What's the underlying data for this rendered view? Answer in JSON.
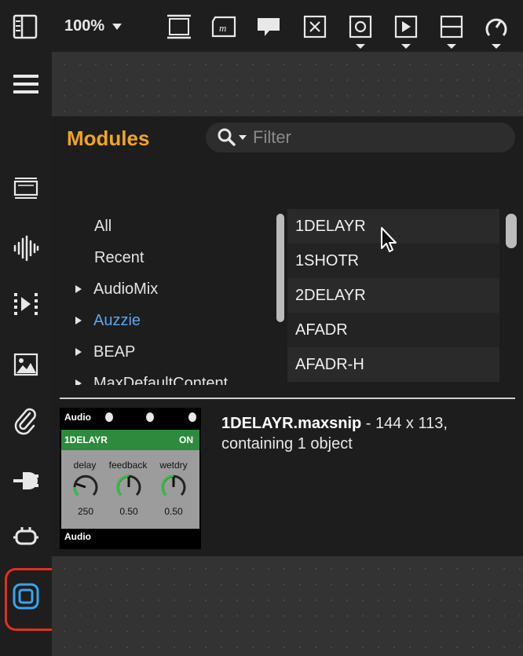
{
  "toolbar": {
    "zoom_value": "100%",
    "icons": [
      "sidebar-toggle-icon",
      "presentation-icon",
      "comment-icon",
      "message-icon",
      "x-box-icon",
      "button-icon",
      "play-icon",
      "slider-icon",
      "dial-icon"
    ]
  },
  "sidebar": {
    "icons": [
      "menu-icon",
      "video-icon",
      "audio-icon",
      "media-icon",
      "image-icon",
      "attachment-icon",
      "plug-icon",
      "connector-icon",
      "snippet-icon"
    ]
  },
  "browser": {
    "title": "Modules",
    "filter_placeholder": "Filter",
    "categories": [
      {
        "label": "All",
        "expandable": false
      },
      {
        "label": "Recent",
        "expandable": false
      },
      {
        "label": "AudioMix",
        "expandable": true
      },
      {
        "label": "Auzzie",
        "expandable": true,
        "active": true
      },
      {
        "label": "BEAP",
        "expandable": true
      },
      {
        "label": "MaxDefaultContent",
        "expandable": true
      }
    ],
    "modules": [
      "1DELAYR",
      "1SHOTR",
      "2DELAYR",
      "AFADR",
      "AFADR-H"
    ]
  },
  "preview": {
    "header": "Audio",
    "module_name": "1DELAYR",
    "state": "ON",
    "knobs": [
      {
        "label": "delay",
        "value": "250"
      },
      {
        "label": "feedback",
        "value": "0.50"
      },
      {
        "label": "wetdry",
        "value": "0.50"
      }
    ],
    "footer": "Audio",
    "file_name": "1DELAYR.maxsnip",
    "file_info": " - 144 x 113, containing 1 object"
  },
  "colors": {
    "accent": "#f0a51c",
    "active_link": "#5aa6ef",
    "highlight_ring": "#e0301e",
    "module_green": "#2e8a3c"
  }
}
